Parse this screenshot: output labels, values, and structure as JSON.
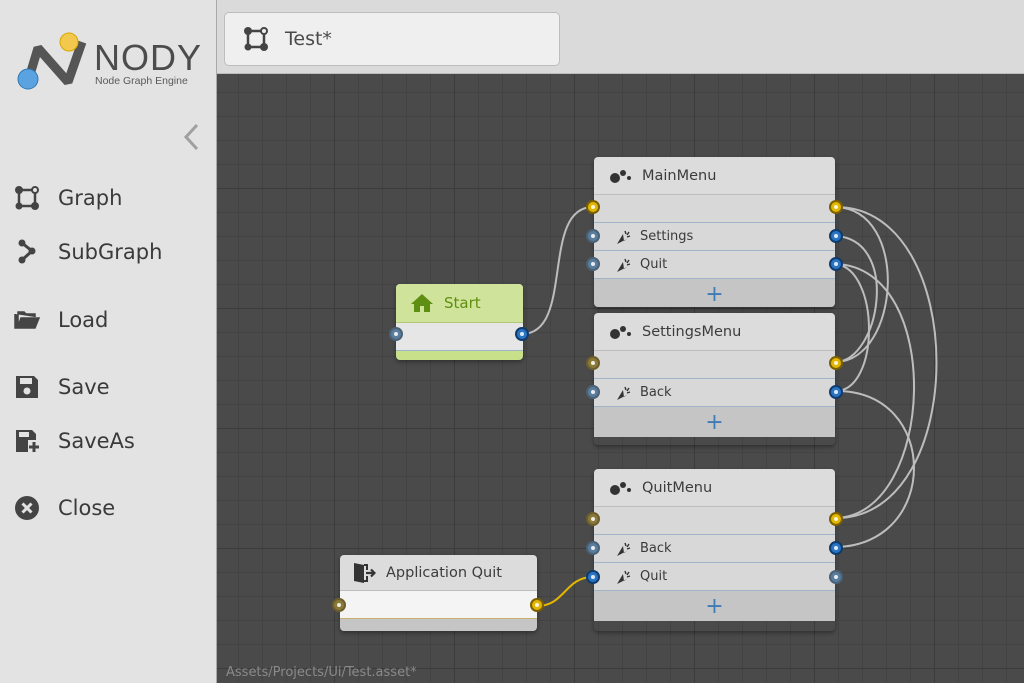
{
  "app": {
    "logo_title": "NODY",
    "logo_subtitle": "Node Graph Engine"
  },
  "sidebar": {
    "items": [
      {
        "label": "Graph",
        "icon": "graph-icon"
      },
      {
        "label": "SubGraph",
        "icon": "subgraph-icon"
      },
      {
        "label": "Load",
        "icon": "folder-icon"
      },
      {
        "label": "Save",
        "icon": "save-icon"
      },
      {
        "label": "SaveAs",
        "icon": "save-as-icon"
      },
      {
        "label": "Close",
        "icon": "close-icon"
      }
    ]
  },
  "tab": {
    "label": "Test*",
    "icon": "graph-icon"
  },
  "footer": {
    "path": "Assets/Projects/Ui/Test.asset*"
  },
  "nodes": {
    "start": {
      "title": "Start",
      "icon": "home-icon"
    },
    "main_menu": {
      "title": "MainMenu",
      "icon": "ui-node-icon",
      "rows": [
        "Settings",
        "Quit"
      ],
      "add": "+"
    },
    "settings_menu": {
      "title": "SettingsMenu",
      "icon": "ui-node-icon",
      "rows": [
        "Back"
      ],
      "add": "+"
    },
    "quit_menu": {
      "title": "QuitMenu",
      "icon": "ui-node-icon",
      "rows": [
        "Back",
        "Quit"
      ],
      "add": "+"
    },
    "app_quit": {
      "title": "Application Quit",
      "icon": "exit-icon"
    }
  },
  "colors": {
    "start_node": "#c8e08a",
    "start_title": "#5f8f12",
    "signal_port": "#e2b600",
    "pass_port": "#2a74c4",
    "wire": "#bdbdbd",
    "active_wire": "#e2b600"
  }
}
